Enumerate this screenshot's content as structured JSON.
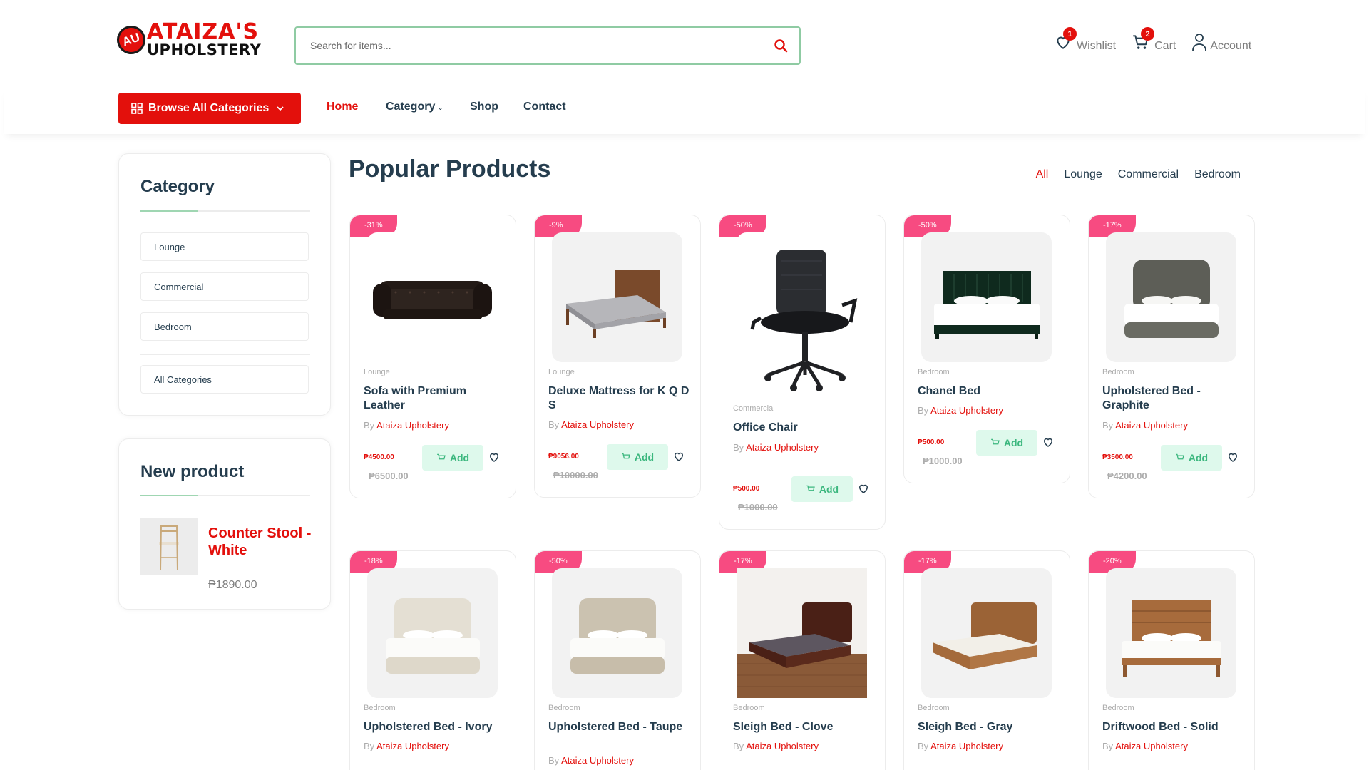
{
  "brand": {
    "line1": "ATAIZA'S",
    "line2": "UPHOLSTERY",
    "mark": "AU"
  },
  "search": {
    "placeholder": "Search for items..."
  },
  "header_actions": {
    "wishlist": {
      "label": "Wishlist",
      "count": "1"
    },
    "cart": {
      "label": "Cart",
      "count": "2"
    },
    "account": {
      "label": "Account"
    }
  },
  "nav": {
    "browse": "Browse  All Categories",
    "links": [
      "Home",
      "Category",
      "Shop",
      "Contact"
    ]
  },
  "sidebar": {
    "category_title": "Category",
    "categories": [
      "Lounge",
      "Commercial",
      "Bedroom"
    ],
    "all_categories": "All Categories",
    "new_title": "New product",
    "new_product": {
      "name": "Counter Stool - White",
      "price": "₱1890.00"
    }
  },
  "main": {
    "title": "Popular Products",
    "filters": [
      "All",
      "Lounge",
      "Commercial",
      "Bedroom"
    ]
  },
  "common": {
    "by": "By",
    "vendor": "Ataiza Upholstery",
    "add": "Add"
  },
  "products": [
    {
      "discount": "-31%",
      "category": "Lounge",
      "name": "Sofa with Premium Leather",
      "price": "₱4500.00",
      "old_price": "₱6500.00"
    },
    {
      "discount": "-9%",
      "category": "Lounge",
      "name": "Deluxe Mattress for K Q D S",
      "price": "₱9056.00",
      "old_price": "₱10000.00"
    },
    {
      "discount": "-50%",
      "category": "Commercial",
      "name": "Office Chair",
      "price": "₱500.00",
      "old_price": "₱1000.00"
    },
    {
      "discount": "-50%",
      "category": "Bedroom",
      "name": "Chanel Bed",
      "price": "₱500.00",
      "old_price": "₱1000.00"
    },
    {
      "discount": "-17%",
      "category": "Bedroom",
      "name": "Upholstered Bed - Graphite",
      "price": "₱3500.00",
      "old_price": "₱4200.00"
    },
    {
      "discount": "-18%",
      "category": "Bedroom",
      "name": "Upholstered Bed - Ivory"
    },
    {
      "discount": "-50%",
      "category": "Bedroom",
      "name": "Upholstered Bed - Taupe"
    },
    {
      "discount": "-17%",
      "category": "Bedroom",
      "name": "Sleigh Bed - Clove"
    },
    {
      "discount": "-17%",
      "category": "Bedroom",
      "name": "Sleigh Bed - Gray"
    },
    {
      "discount": "-20%",
      "category": "Bedroom",
      "name": "Driftwood Bed - Solid"
    }
  ],
  "colors": {
    "accent": "#e3100c",
    "discount": "#f74b81",
    "add_bg": "#def9ec",
    "add_text": "#3bb77e"
  }
}
